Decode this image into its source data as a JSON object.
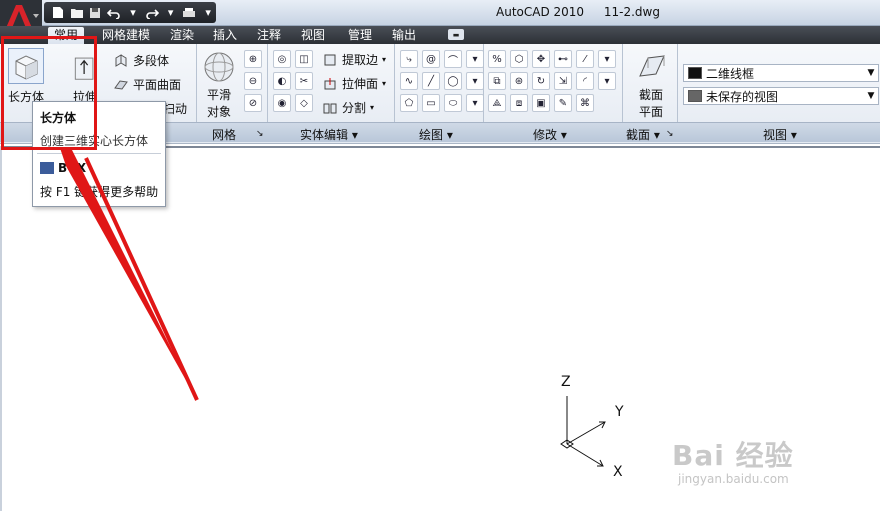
{
  "window": {
    "app_name": "AutoCAD 2010",
    "file_name": "11-2.dwg"
  },
  "tabs": [
    "常用",
    "网格建模",
    "渲染",
    "插入",
    "注释",
    "视图",
    "管理",
    "输出"
  ],
  "ribbon": {
    "box_label": "长方体",
    "extrude_label": "拉伸",
    "polysolid_label": "多段体",
    "planar_surface_label": "平面曲面",
    "sweep_partial": "扫动",
    "smooth_label_1": "平滑",
    "smooth_label_2": "对象",
    "extract_edges": "提取边",
    "extrude_faces": "拉伸面",
    "slice": "分割",
    "section_label_1": "截面",
    "section_label_2": "平面",
    "visual_style": "二维线框",
    "saved_view": "未保存的视图",
    "panels": {
      "mesh": "网格",
      "solid_edit": "实体编辑",
      "draw": "绘图",
      "modify": "修改",
      "section": "截面",
      "view": "视图"
    }
  },
  "tooltip": {
    "title": "长方体",
    "description": "创建三维实心长方体",
    "command": "BOX",
    "help": "按 F1 键获得更多帮助"
  },
  "ucs": {
    "z": "Z",
    "y": "Y",
    "x": "X"
  },
  "watermark": {
    "brand": "Bai 经验",
    "url": "jingyan.baidu.com"
  },
  "colors": {
    "highlight": "#e01616",
    "accent": "#d8232a"
  }
}
